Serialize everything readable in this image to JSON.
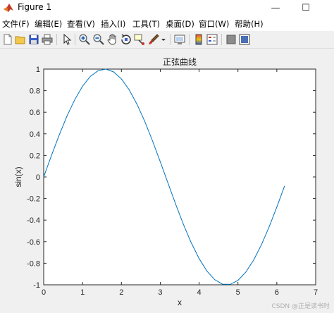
{
  "window": {
    "title": "Figure 1",
    "minimize_glyph": "—",
    "maximize_glyph": "☐"
  },
  "menu": {
    "items": [
      "文件(F)",
      "编辑(E)",
      "查看(V)",
      "插入(I)",
      "工具(T)",
      "桌面(D)",
      "窗口(W)",
      "帮助(H)"
    ]
  },
  "toolbar": {
    "icons": [
      "new-file-icon",
      "open-file-icon",
      "save-icon",
      "print-icon",
      "pointer-icon",
      "zoom-in-icon",
      "zoom-out-icon",
      "pan-icon",
      "rotate-3d-icon",
      "data-cursor-icon",
      "brush-icon",
      "link-plot-icon",
      "colorbar-icon",
      "legend-icon",
      "hide-plot-tools-icon",
      "show-plot-tools-icon"
    ]
  },
  "watermark": "CSDN @正是读书时",
  "chart_data": {
    "type": "line",
    "title": "正弦曲线",
    "xlabel": "x",
    "ylabel": "sin(x)",
    "xlim": [
      0,
      7
    ],
    "ylim": [
      -1,
      1
    ],
    "xticks": [
      "0",
      "1",
      "2",
      "3",
      "4",
      "5",
      "6",
      "7"
    ],
    "yticks": [
      "-1",
      "-0.8",
      "-0.6",
      "-0.4",
      "-0.2",
      "0",
      "0.2",
      "0.4",
      "0.6",
      "0.8",
      "1"
    ],
    "grid": false,
    "series": [
      {
        "color": "#0072bd",
        "x": [
          0,
          0.2,
          0.4,
          0.6,
          0.8,
          1.0,
          1.2,
          1.4,
          1.6,
          1.8,
          2.0,
          2.2,
          2.4,
          2.6,
          2.8,
          3.0,
          3.2,
          3.4,
          3.6,
          3.8,
          4.0,
          4.2,
          4.4,
          4.6,
          4.8,
          5.0,
          5.2,
          5.4,
          5.6,
          5.8,
          6.0,
          6.2
        ],
        "y": [
          0,
          0.199,
          0.389,
          0.565,
          0.717,
          0.841,
          0.932,
          0.985,
          1.0,
          0.974,
          0.909,
          0.808,
          0.675,
          0.516,
          0.335,
          0.141,
          -0.058,
          -0.256,
          -0.443,
          -0.612,
          -0.757,
          -0.872,
          -0.952,
          -0.994,
          -0.996,
          -0.959,
          -0.883,
          -0.773,
          -0.631,
          -0.465,
          -0.279,
          -0.083
        ]
      }
    ]
  }
}
